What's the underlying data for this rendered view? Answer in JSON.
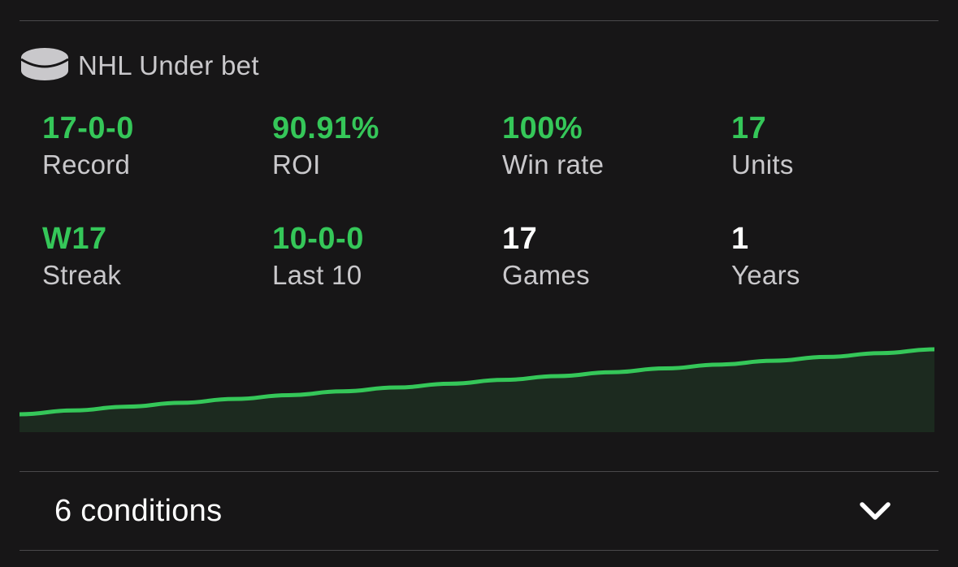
{
  "header": {
    "icon": "hockey-puck-icon",
    "title": "NHL Under bet"
  },
  "stats": {
    "record": {
      "value": "17-0-0",
      "label": "Record"
    },
    "roi": {
      "value": "90.91%",
      "label": "ROI"
    },
    "win_rate": {
      "value": "100%",
      "label": "Win rate"
    },
    "units": {
      "value": "17",
      "label": "Units"
    },
    "streak": {
      "value": "W17",
      "label": "Streak"
    },
    "last10": {
      "value": "10-0-0",
      "label": "Last 10"
    },
    "games": {
      "value": "17",
      "label": "Games"
    },
    "years": {
      "value": "1",
      "label": "Years"
    }
  },
  "chart_data": {
    "type": "area",
    "x": [
      0,
      1,
      2,
      3,
      4,
      5,
      6,
      7,
      8,
      9,
      10,
      11,
      12,
      13,
      14,
      15,
      16,
      17
    ],
    "values": [
      0,
      1,
      2,
      3,
      4,
      5,
      6,
      7,
      8,
      9,
      10,
      11,
      12,
      13,
      14,
      15,
      16,
      17
    ],
    "title": "",
    "xlabel": "",
    "ylabel": "",
    "grid": false,
    "line_color": "#35c759",
    "fill_color": "#1c2a1f"
  },
  "conditions": {
    "label": "6 conditions",
    "icon": "chevron-down-icon"
  },
  "colors": {
    "background": "#171617",
    "accent_green": "#35c759",
    "label_gray": "#c9c8cb",
    "divider": "#4a494b"
  }
}
